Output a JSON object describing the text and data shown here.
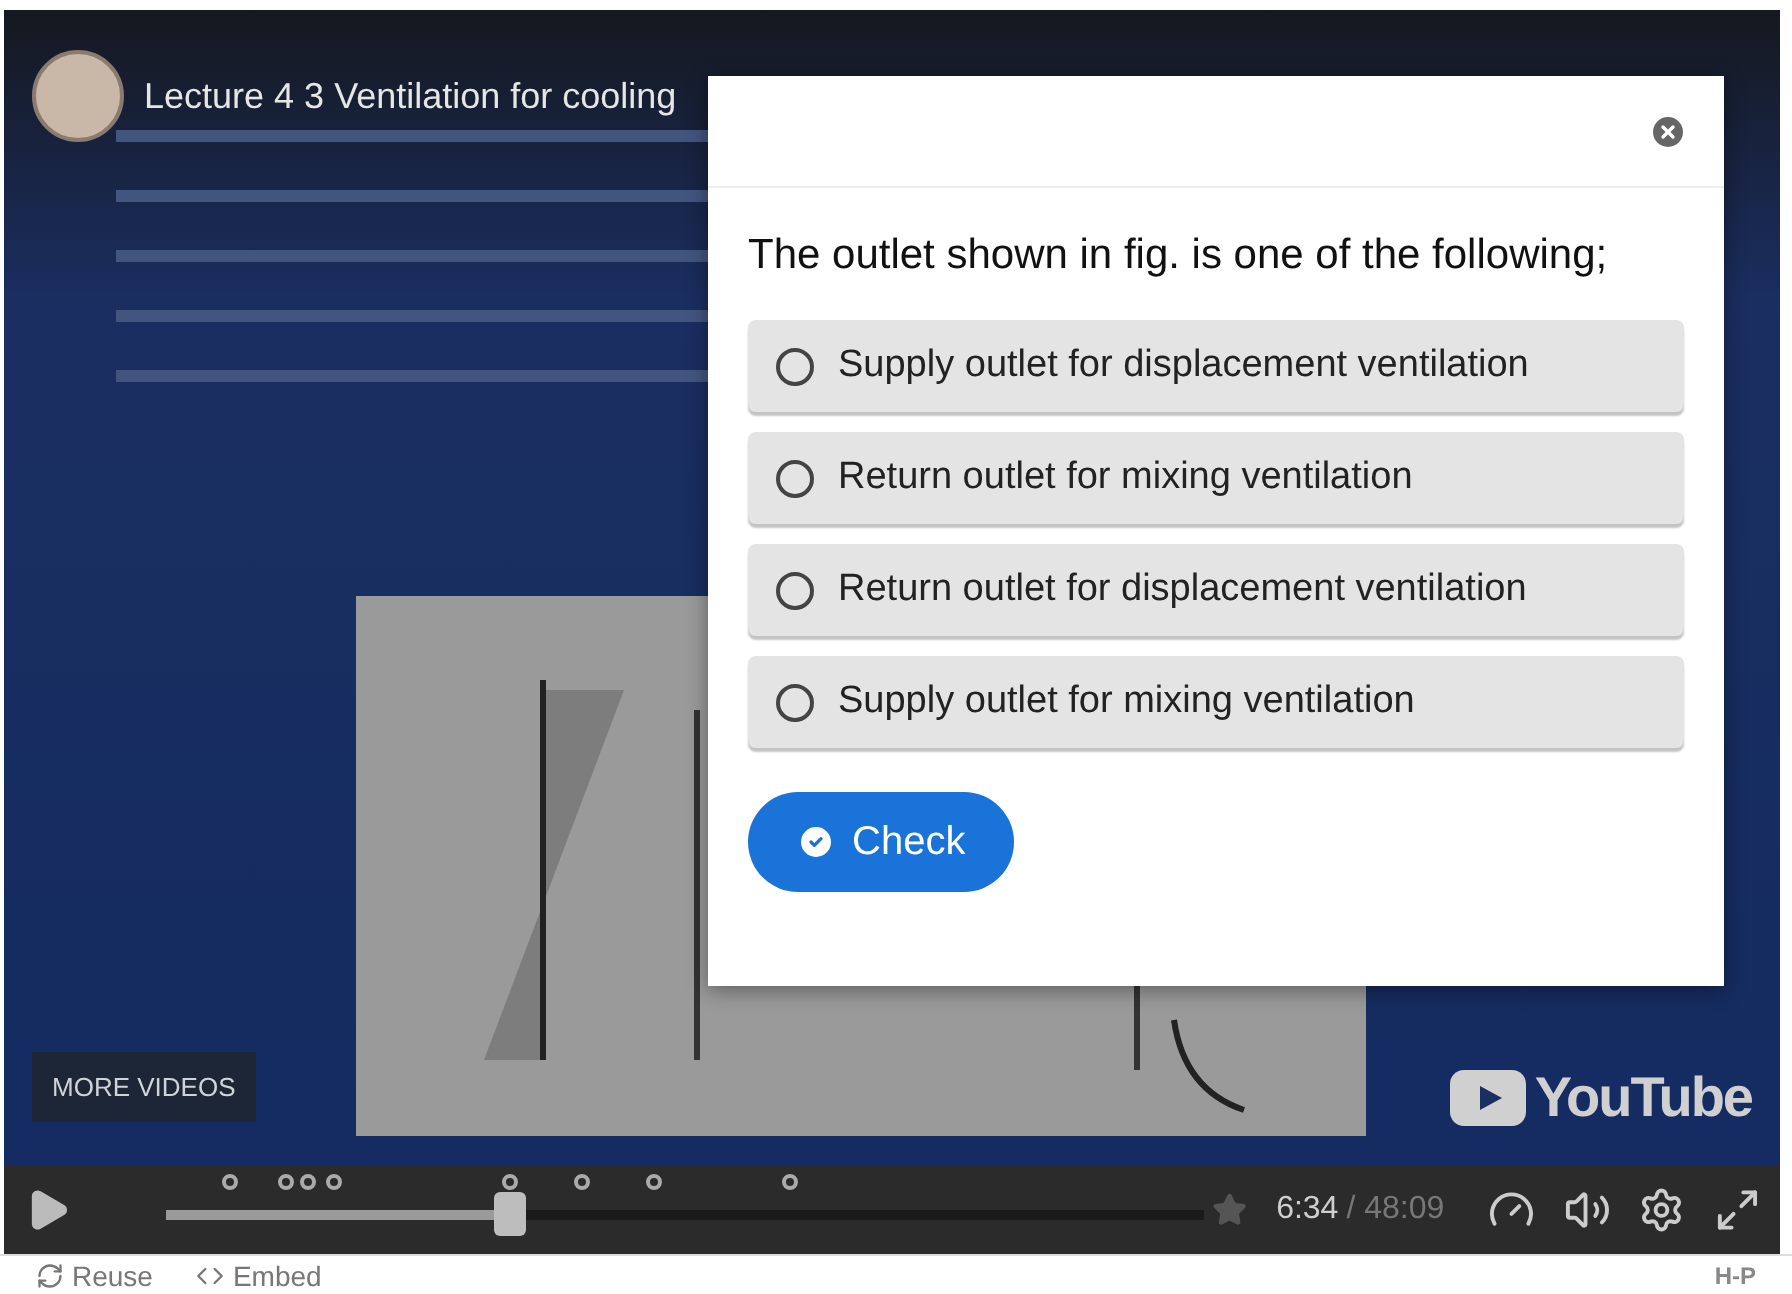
{
  "video": {
    "kind": "picture",
    "channel_title": "Lecture 4 3 Ventilation for cooling",
    "more_videos": "MORE VIDEOS",
    "logo_text": "YouTube"
  },
  "dialog": {
    "question": "The outlet shown in fig. is one of the following;",
    "options": [
      {
        "label": "Supply outlet for displacement ventilation",
        "selected": false
      },
      {
        "label": "Return outlet for mixing ventilation",
        "selected": false
      },
      {
        "label": "Return outlet for displacement ventilation",
        "selected": false
      },
      {
        "label": "Supply outlet for mixing ventilation",
        "selected": false
      }
    ],
    "button": "Check"
  },
  "controls": {
    "level": 0.33,
    "current_time": "6:34",
    "total_time": "/ 48:09"
  },
  "footer": {
    "links": [
      "Reuse",
      "Embed"
    ],
    "logo": "H-P"
  }
}
